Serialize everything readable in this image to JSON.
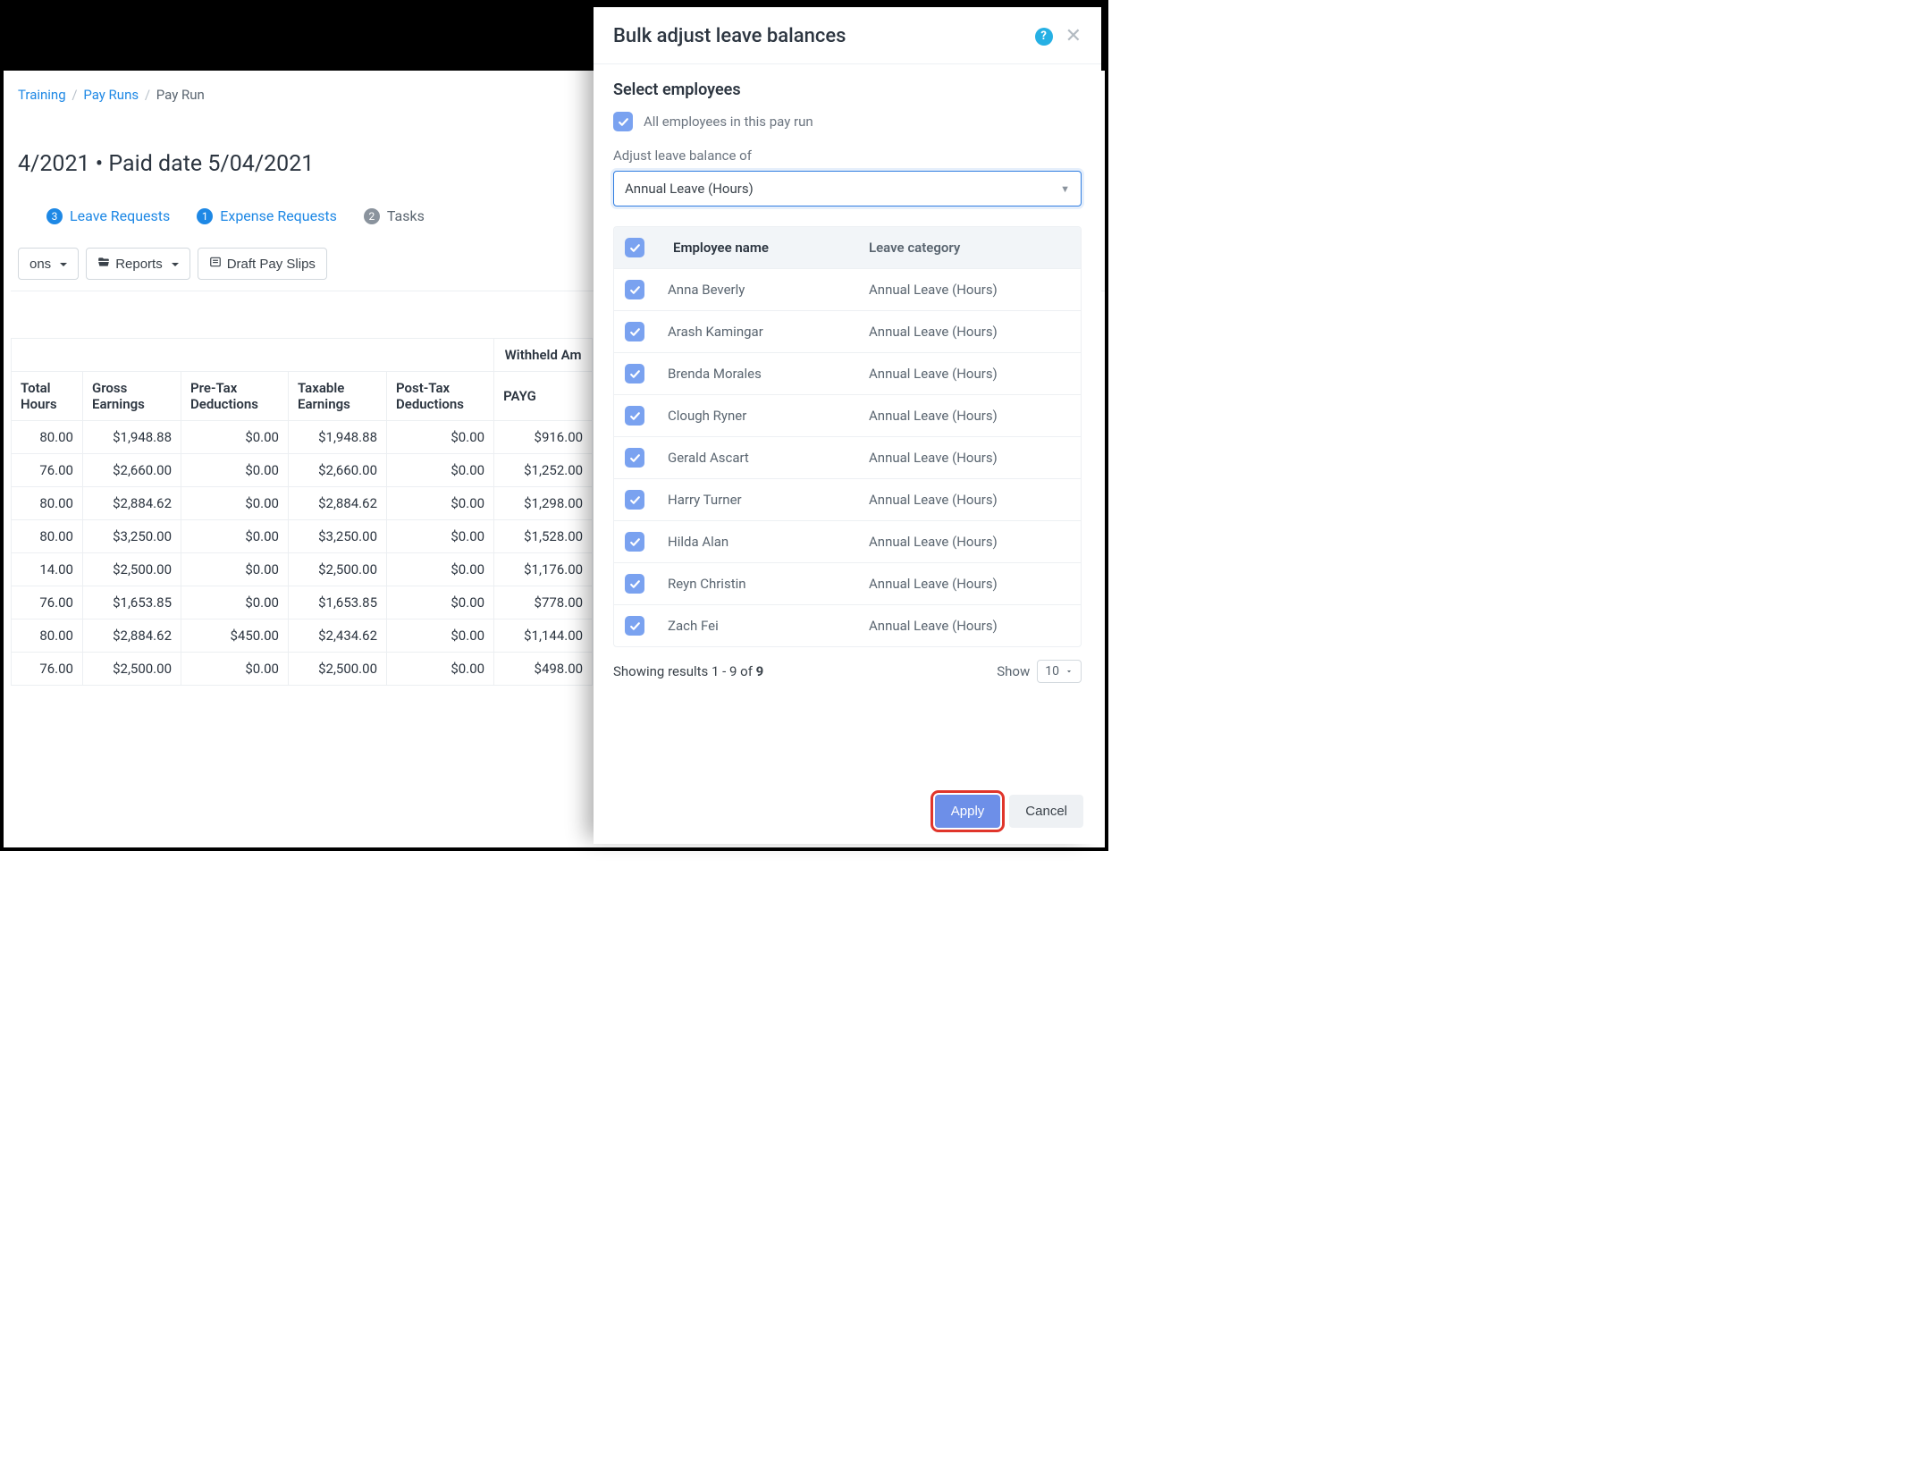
{
  "breadcrumb": {
    "a": "Training",
    "b": "Pay Runs",
    "c": "Pay Run"
  },
  "page_title": "4/2021 • Paid date 5/04/2021",
  "tabs": {
    "leave": {
      "count": "3",
      "label": "Leave Requests"
    },
    "expense": {
      "count": "1",
      "label": "Expense Requests"
    },
    "tasks": {
      "count": "2",
      "label": "Tasks"
    }
  },
  "toolbar": {
    "ons": "ons",
    "reports": "Reports",
    "draft": "Draft Pay Slips"
  },
  "grid": {
    "withheld_header": "Withheld Am",
    "cols": [
      "Total Hours",
      "Gross Earnings",
      "Pre-Tax Deductions",
      "Taxable Earnings",
      "Post-Tax Deductions",
      "PAYG"
    ],
    "rows": [
      [
        "80.00",
        "$1,948.88",
        "$0.00",
        "$1,948.88",
        "$0.00",
        "$916.00"
      ],
      [
        "76.00",
        "$2,660.00",
        "$0.00",
        "$2,660.00",
        "$0.00",
        "$1,252.00"
      ],
      [
        "80.00",
        "$2,884.62",
        "$0.00",
        "$2,884.62",
        "$0.00",
        "$1,298.00"
      ],
      [
        "80.00",
        "$3,250.00",
        "$0.00",
        "$3,250.00",
        "$0.00",
        "$1,528.00"
      ],
      [
        "14.00",
        "$2,500.00",
        "$0.00",
        "$2,500.00",
        "$0.00",
        "$1,176.00"
      ],
      [
        "76.00",
        "$1,653.85",
        "$0.00",
        "$1,653.85",
        "$0.00",
        "$778.00"
      ],
      [
        "80.00",
        "$2,884.62",
        "$450.00",
        "$2,434.62",
        "$0.00",
        "$1,144.00"
      ],
      [
        "76.00",
        "$2,500.00",
        "$0.00",
        "$2,500.00",
        "$0.00",
        "$498.00"
      ]
    ]
  },
  "panel": {
    "title": "Bulk adjust leave balances",
    "section_title": "Select employees",
    "all_employees": "All employees in this pay run",
    "adjust_label": "Adjust leave balance of",
    "select_value": "Annual Leave (Hours)",
    "col_name": "Employee name",
    "col_cat": "Leave category",
    "employees": [
      {
        "name": "Anna Beverly",
        "cat": "Annual Leave (Hours)"
      },
      {
        "name": "Arash Kamingar",
        "cat": "Annual Leave (Hours)"
      },
      {
        "name": "Brenda Morales",
        "cat": "Annual Leave (Hours)"
      },
      {
        "name": "Clough Ryner",
        "cat": "Annual Leave (Hours)"
      },
      {
        "name": "Gerald Ascart",
        "cat": "Annual Leave (Hours)"
      },
      {
        "name": "Harry Turner",
        "cat": "Annual Leave (Hours)"
      },
      {
        "name": "Hilda Alan",
        "cat": "Annual Leave (Hours)"
      },
      {
        "name": "Reyn Christin",
        "cat": "Annual Leave (Hours)"
      },
      {
        "name": "Zach Fei",
        "cat": "Annual Leave (Hours)"
      }
    ],
    "results_text_pre": "Showing results 1 - 9 of ",
    "results_total": "9",
    "show_label": "Show",
    "show_value": "10",
    "apply": "Apply",
    "cancel": "Cancel"
  }
}
